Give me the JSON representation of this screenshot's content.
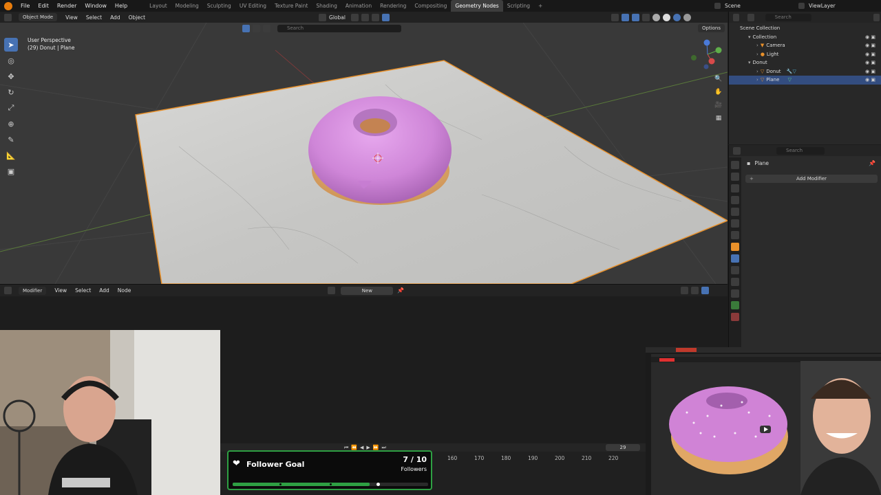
{
  "menubar": {
    "menus": [
      "File",
      "Edit",
      "Render",
      "Window",
      "Help"
    ],
    "workspaces": [
      "Layout",
      "Modeling",
      "Sculpting",
      "UV Editing",
      "Texture Paint",
      "Shading",
      "Animation",
      "Rendering",
      "Compositing",
      "Geometry Nodes",
      "Scripting"
    ],
    "active_workspace": "Geometry Nodes",
    "scene": "Scene",
    "view_layer": "ViewLayer"
  },
  "viewport_header": {
    "mode": "Object Mode",
    "menus": [
      "View",
      "Select",
      "Add",
      "Object"
    ],
    "orientation": "Global",
    "search_placeholder": "Search",
    "options": "Options"
  },
  "viewport": {
    "perspective": "User Perspective",
    "object_info": "(29) Donut | Plane"
  },
  "outliner": {
    "search_placeholder": "Search",
    "items": [
      {
        "label": "Scene Collection",
        "depth": 0
      },
      {
        "label": "Collection",
        "depth": 1
      },
      {
        "label": "Camera",
        "depth": 2
      },
      {
        "label": "Light",
        "depth": 2
      },
      {
        "label": "Donut",
        "depth": 1
      },
      {
        "label": "Donut",
        "depth": 2
      },
      {
        "label": "Plane",
        "depth": 2,
        "selected": true
      }
    ]
  },
  "properties": {
    "search_placeholder": "Search",
    "object_name": "Plane",
    "add_modifier": "Add Modifier"
  },
  "node_editor": {
    "context": "Modifier",
    "menus": [
      "View",
      "Select",
      "Add",
      "Node"
    ],
    "new_button": "New"
  },
  "timeline": {
    "current_frame": "29",
    "ticks": [
      "160",
      "170",
      "180",
      "190",
      "200",
      "210",
      "220"
    ]
  },
  "follower_goal": {
    "title": "Follower Goal",
    "count": "7 / 10",
    "unit": "Followers",
    "progress": 0.7
  },
  "colors": {
    "accent_blue": "#4772b3",
    "selection": "#334d80",
    "goal_green": "#2ea043",
    "frosting_pink": "#cf86d8"
  }
}
